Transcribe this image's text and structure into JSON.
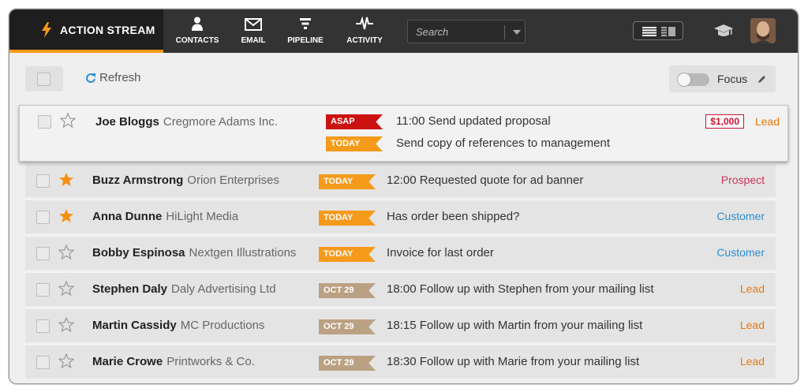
{
  "header": {
    "brand": "ACTION STREAM",
    "nav": [
      {
        "label": "CONTACTS",
        "icon": "person-icon"
      },
      {
        "label": "EMAIL",
        "icon": "envelope-icon"
      },
      {
        "label": "PIPELINE",
        "icon": "funnel-icon"
      },
      {
        "label": "ACTIVITY",
        "icon": "pulse-icon"
      }
    ],
    "search_placeholder": "Search",
    "accent": "#f59a1b"
  },
  "toolbar": {
    "refresh_label": "Refresh",
    "focus_label": "Focus"
  },
  "rows": [
    {
      "name": "Joe Bloggs",
      "company": "Cregmore Adams Inc.",
      "starred": false,
      "tasks": [
        {
          "tag": "ASAP",
          "text": "11:00 Send updated proposal"
        },
        {
          "tag": "TODAY",
          "text": "Send copy of references to management"
        }
      ],
      "amount": "$1,000",
      "status": "Lead"
    },
    {
      "name": "Buzz Armstrong",
      "company": "Orion Enterprises",
      "starred": true,
      "tag": "TODAY",
      "task": "12:00 Requested quote for ad banner",
      "status": "Prospect"
    },
    {
      "name": "Anna Dunne",
      "company": "HiLight Media",
      "starred": true,
      "tag": "TODAY",
      "task": "Has order been shipped?",
      "status": "Customer"
    },
    {
      "name": "Bobby Espinosa",
      "company": "Nextgen Illustrations",
      "starred": false,
      "tag": "TODAY",
      "task": "Invoice for last order",
      "status": "Customer"
    },
    {
      "name": "Stephen Daly",
      "company": "Daly Advertising Ltd",
      "starred": false,
      "tag": "OCT 29",
      "task": "18:00 Follow up with Stephen from your mailing list",
      "status": "Lead"
    },
    {
      "name": "Martin Cassidy",
      "company": "MC Productions",
      "starred": false,
      "tag": "OCT 29",
      "task": "18:15 Follow up with Martin from your mailing list",
      "status": "Lead"
    },
    {
      "name": "Marie Crowe",
      "company": "Printworks & Co.",
      "starred": false,
      "tag": "OCT 29",
      "task": "18:30 Follow up with Marie from your mailing list",
      "status": "Lead"
    }
  ]
}
